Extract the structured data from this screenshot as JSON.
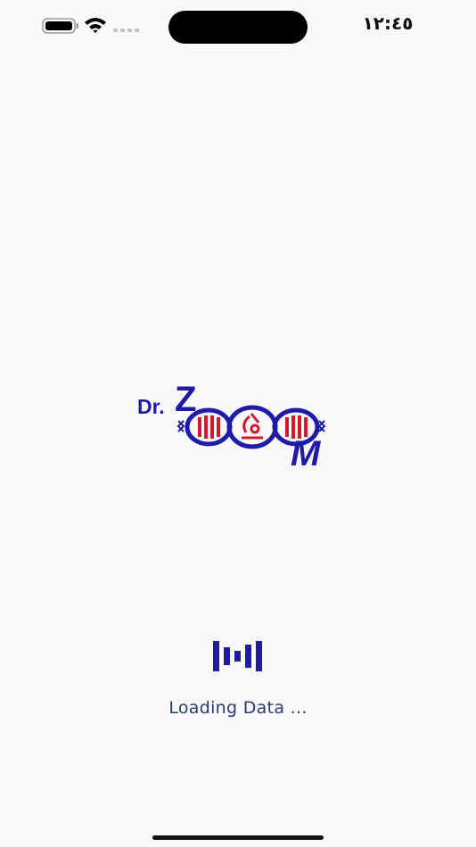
{
  "status_bar": {
    "time": "١٢:٤٥",
    "battery_icon": "battery-full-icon",
    "wifi_icon": "wifi-icon",
    "signal_icon": "cellular-signal-dots-icon"
  },
  "logo": {
    "text_dr": "Dr.",
    "brand_letters": [
      "Z",
      "M"
    ],
    "colors": {
      "navy": "#1f1aa8",
      "red": "#d3192b"
    }
  },
  "loader": {
    "icon": "loading-bars-icon",
    "label": "Loading Data ..."
  }
}
